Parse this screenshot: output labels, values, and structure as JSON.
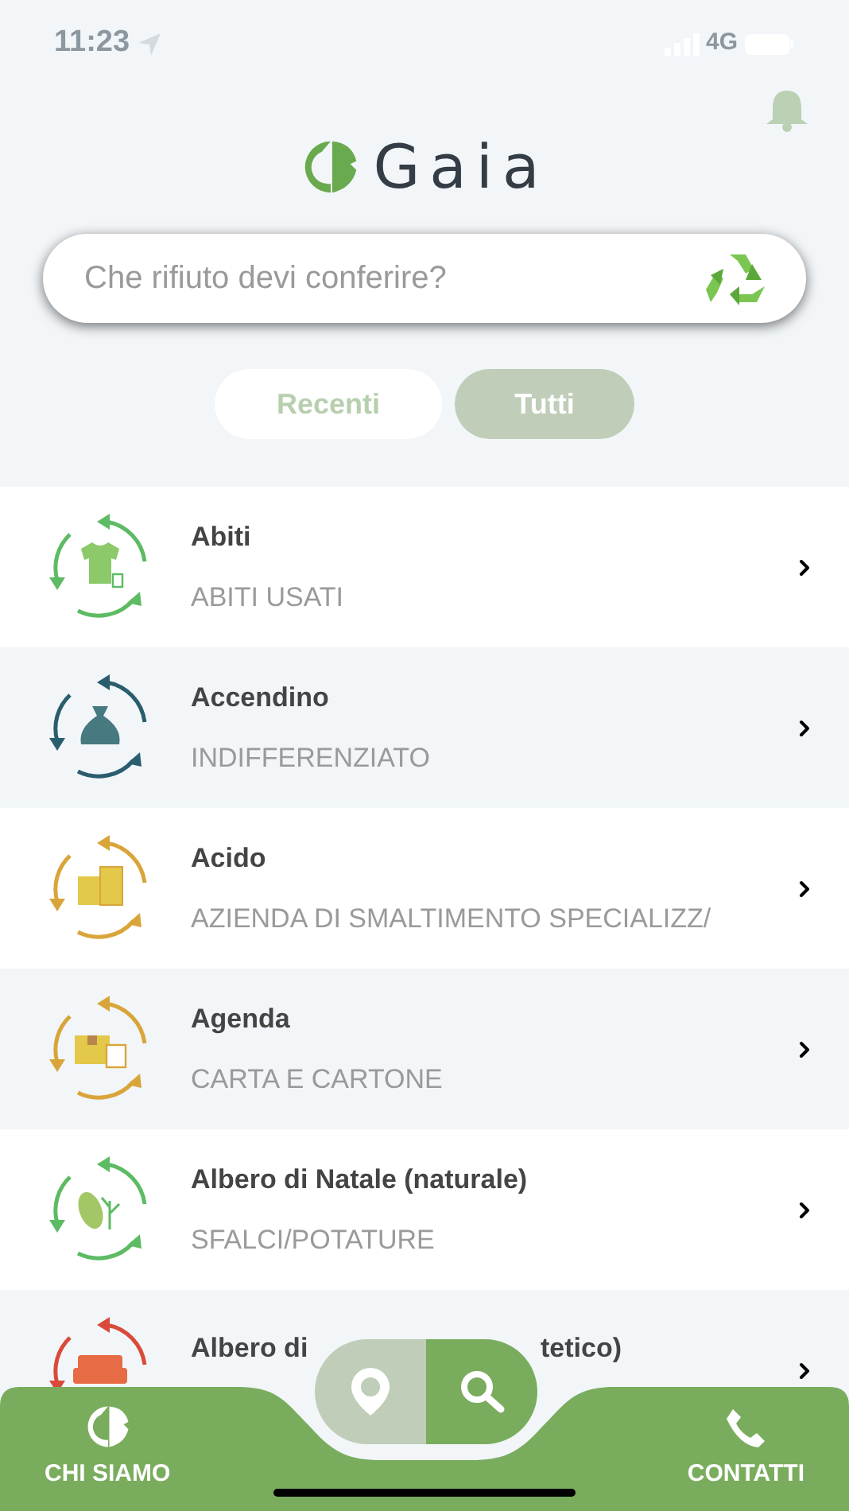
{
  "status_bar": {
    "time": "11:23",
    "network": "4G"
  },
  "logo": {
    "text": "Gaia"
  },
  "search": {
    "placeholder": "Che rifiuto devi conferire?"
  },
  "tabs": [
    {
      "label": "Recenti",
      "selected": false
    },
    {
      "label": "Tutti",
      "selected": true
    }
  ],
  "items": [
    {
      "title": "Abiti",
      "category": "ABITI USATI",
      "kind": "clothes",
      "color": "#5dbb63"
    },
    {
      "title": "Accendino",
      "category": "INDIFFERENZIATO",
      "kind": "bag",
      "color": "#2a5d6e"
    },
    {
      "title": "Acido",
      "category": "AZIENDA DI SMALTIMENTO SPECIALIZZ/",
      "kind": "building",
      "color": "#d9a53a"
    },
    {
      "title": "Agenda",
      "category": "CARTA E CARTONE",
      "kind": "box",
      "color": "#d9a53a"
    },
    {
      "title": "Albero di Natale (naturale)",
      "category": "SFALCI/POTATURE",
      "kind": "leaf",
      "color": "#5dbb63"
    },
    {
      "title_parts": [
        "Albero di",
        "tetico)"
      ],
      "kind": "sofa",
      "color": "#d94a3a"
    }
  ],
  "map_switch": [
    {
      "kind": "map",
      "selected": false
    },
    {
      "kind": "search",
      "selected": true
    }
  ],
  "bottom_nav": [
    {
      "label": "CHI SIAMO",
      "kind": "about"
    },
    {
      "label": "CONTATTI",
      "kind": "contacts"
    }
  ]
}
